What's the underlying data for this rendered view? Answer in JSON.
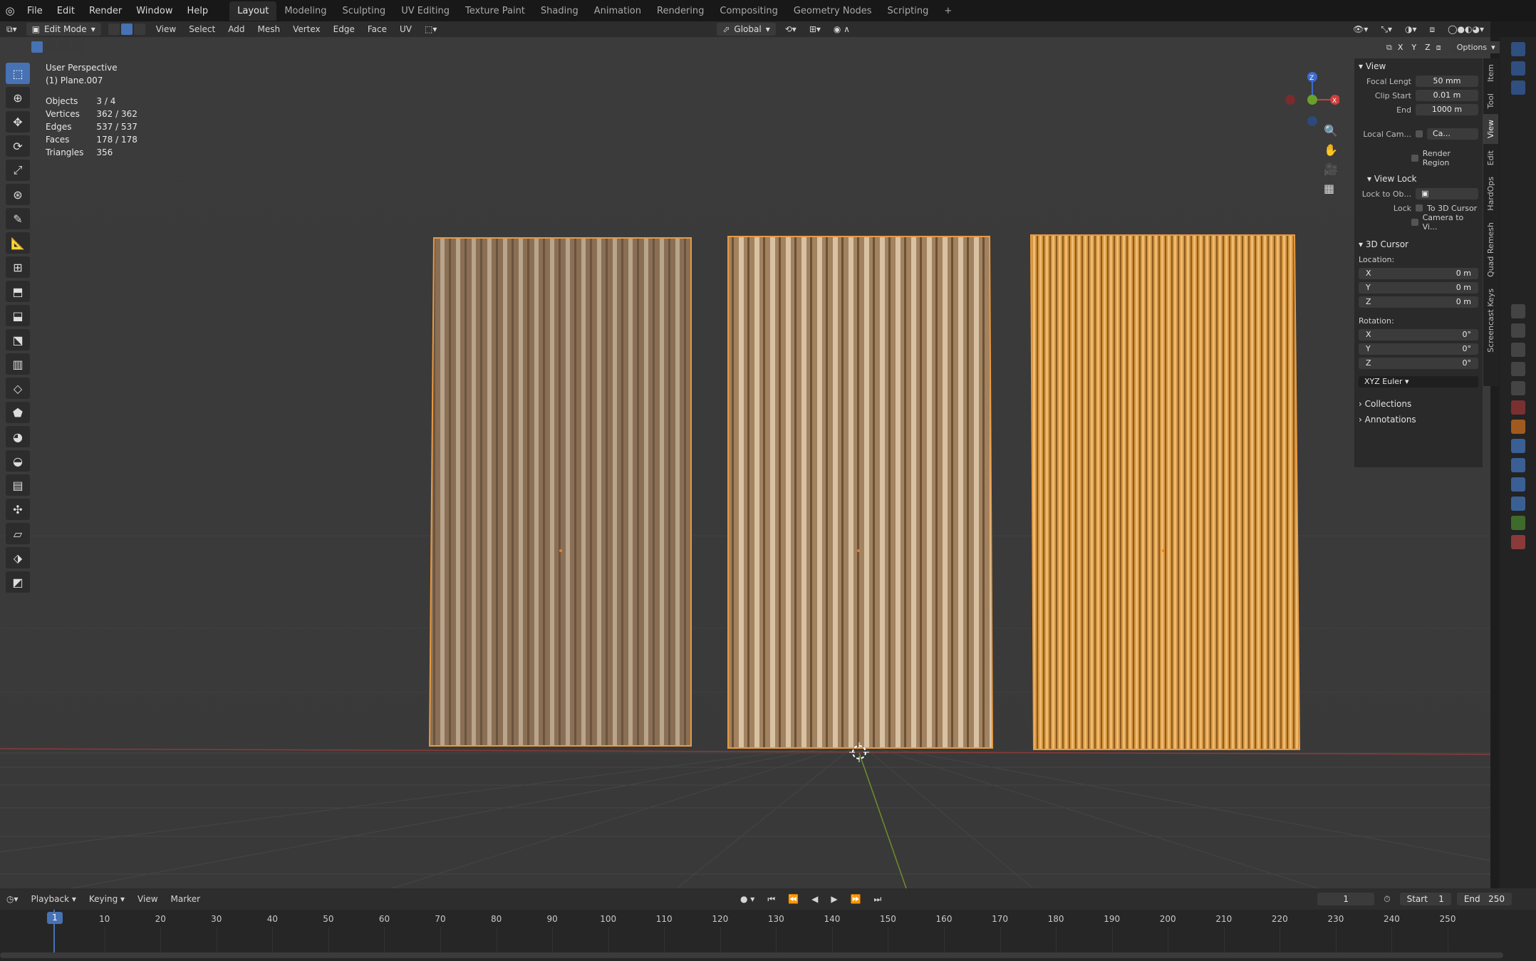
{
  "topbar": {
    "menus": [
      "File",
      "Edit",
      "Render",
      "Window",
      "Help"
    ],
    "workspaces": [
      "Layout",
      "Modeling",
      "Sculpting",
      "UV Editing",
      "Texture Paint",
      "Shading",
      "Animation",
      "Rendering",
      "Compositing",
      "Geometry Nodes",
      "Scripting"
    ],
    "active_workspace": "Layout",
    "add_tab": "+"
  },
  "header": {
    "mode": "Edit Mode",
    "menus": [
      "View",
      "Select",
      "Add",
      "Mesh",
      "Vertex",
      "Edge",
      "Face",
      "UV"
    ],
    "transform_orientation": "Global",
    "options_label": "Options",
    "axis_x": "X",
    "axis_y": "Y",
    "axis_z": "Z"
  },
  "viewport": {
    "perspective": "User Perspective",
    "object_name": "(1) Plane.007",
    "stats": [
      {
        "label": "Objects",
        "value": "3 / 4"
      },
      {
        "label": "Vertices",
        "value": "362 / 362"
      },
      {
        "label": "Edges",
        "value": "537 / 537"
      },
      {
        "label": "Faces",
        "value": "178 / 178"
      },
      {
        "label": "Triangles",
        "value": "356"
      }
    ],
    "gizmo": {
      "x": "X",
      "y": "Y",
      "z": "Z"
    }
  },
  "npanel": {
    "view_header": "View",
    "focal_label": "Focal Lengt",
    "focal_value": "50 mm",
    "clip_start_label": "Clip Start",
    "clip_start_value": "0.01 m",
    "end_label": "End",
    "end_value": "1000 m",
    "local_cam_label": "Local Cam...",
    "local_cam_value": "Ca...",
    "render_region": "Render Region",
    "view_lock_header": "View Lock",
    "lock_to_obj_label": "Lock to Ob...",
    "lock_label": "Lock",
    "to_3d_cursor": "To 3D Cursor",
    "camera_to_view": "Camera to Vi...",
    "cursor_header": "3D Cursor",
    "location_label": "Location:",
    "loc": [
      {
        "axis": "X",
        "val": "0 m"
      },
      {
        "axis": "Y",
        "val": "0 m"
      },
      {
        "axis": "Z",
        "val": "0 m"
      }
    ],
    "rotation_label": "Rotation:",
    "rot": [
      {
        "axis": "X",
        "val": "0°"
      },
      {
        "axis": "Y",
        "val": "0°"
      },
      {
        "axis": "Z",
        "val": "0°"
      }
    ],
    "rotation_mode": "XYZ Euler",
    "collections": "Collections",
    "annotations": "Annotations"
  },
  "vtabs": [
    "Item",
    "Tool",
    "View",
    "Edit",
    "HardOps",
    "Quad Remesh",
    "Screencast Keys"
  ],
  "timeline": {
    "menus": [
      "Playback",
      "Keying",
      "View",
      "Marker"
    ],
    "current_frame": "1",
    "start_label": "Start",
    "start_value": "1",
    "end_label": "End",
    "end_value": "250",
    "ticks": [
      "1",
      "10",
      "20",
      "30",
      "40",
      "50",
      "60",
      "70",
      "80",
      "90",
      "100",
      "110",
      "120",
      "130",
      "140",
      "150",
      "160",
      "170",
      "180",
      "190",
      "200",
      "210",
      "220",
      "230",
      "240",
      "250"
    ]
  }
}
